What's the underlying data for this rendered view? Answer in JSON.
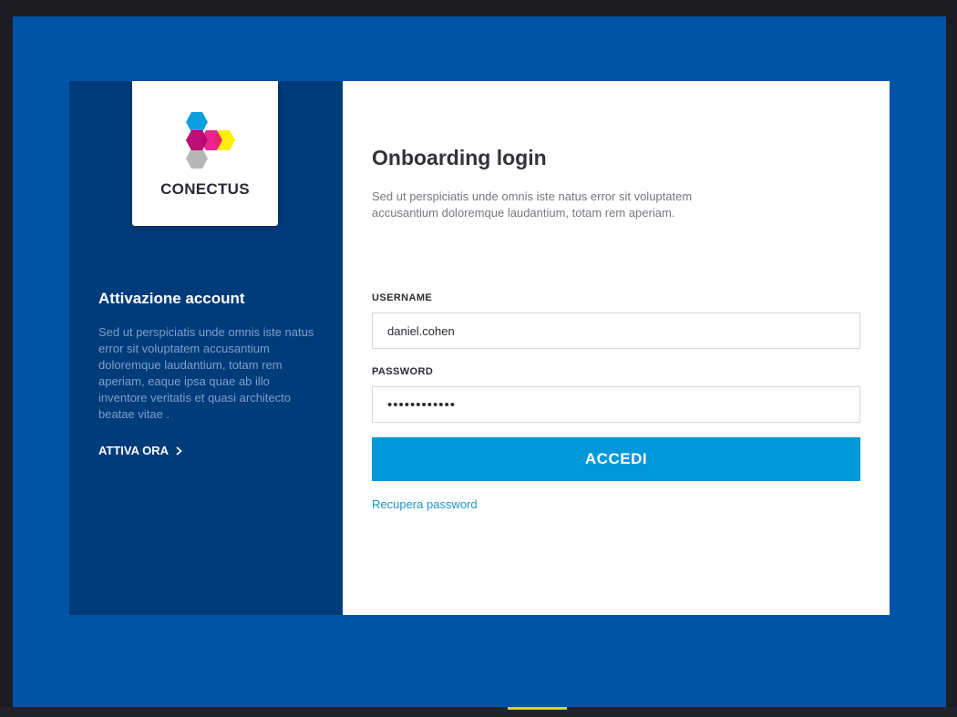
{
  "brand": {
    "logo_icon": "hexagon-cluster-icon",
    "name": "CONECTUS",
    "colors": {
      "cyan": "#0099dd",
      "magenta": "#e5007e",
      "yellow": "#ffed00",
      "gray": "#b3b3b3"
    }
  },
  "left": {
    "title": "Attivazione account",
    "description": "Sed ut perspiciatis unde omnis iste natus error sit voluptatem accusantium doloremque laudantium, totam rem aperiam, eaque ipsa quae ab illo inventore veritatis et quasi architecto beatae vitae .",
    "cta_label": "ATTIVA ORA",
    "cta_icon": "chevron-right-icon"
  },
  "form": {
    "title": "Onboarding login",
    "description": "Sed ut perspiciatis unde omnis iste natus error sit voluptatem accusantium doloremque laudantium, totam rem aperiam.",
    "username_label": "USERNAME",
    "username_value": "daniel.cohen",
    "password_label": "PASSWORD",
    "password_value": "••••••••••••",
    "submit_label": "ACCEDI",
    "recover_label": "Recupera password"
  },
  "theme": {
    "background": "#0053a6",
    "left_panel": "#003b7a",
    "button": "#0098d8",
    "link": "#1a97d0"
  }
}
